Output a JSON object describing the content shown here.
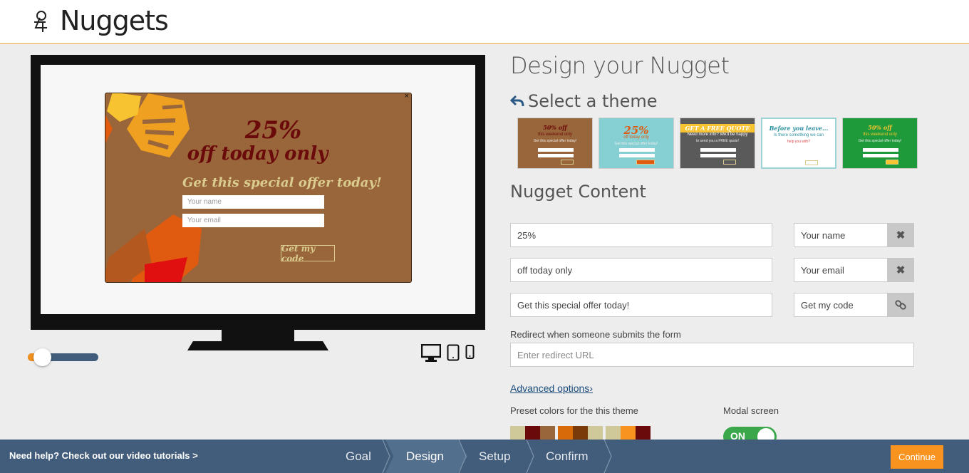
{
  "header": {
    "logo_text": "Nuggets"
  },
  "preview": {
    "popup": {
      "headline": "25%",
      "subheadline": "off today only",
      "offer_text": "Get this special offer today!",
      "name_placeholder": "Your name",
      "email_placeholder": "Your email",
      "button_label": "Get my code",
      "close_glyph": "×"
    },
    "size_slider": {
      "value_fraction": 0.2
    },
    "devices": [
      "desktop-icon",
      "tablet-icon",
      "phone-icon"
    ]
  },
  "panel": {
    "title": "Design your Nugget",
    "theme_section_title": "Select a theme",
    "themes": [
      {
        "name": "autumn",
        "bg": "#99653a",
        "line1": "50% off",
        "line2": "this weekend only",
        "line3": "Get this special offer today!"
      },
      {
        "name": "teal",
        "bg": "#86cfd3",
        "line1": "25%",
        "line2": "off today only",
        "line3": "Get this special offer today!"
      },
      {
        "name": "quote",
        "bg": "#5a5a5a",
        "line1": "GET A FREE QUOTE",
        "line2": "Need more info? We'll be happy",
        "line3": "to send you a FREE quote!"
      },
      {
        "name": "letter",
        "bg": "#ffffff",
        "line1": "Before you leave...",
        "line2": "Is there something we can",
        "line3": "help you with?"
      },
      {
        "name": "green",
        "bg": "#1e9a3a",
        "line1": "50% off",
        "line2": "this weekend only",
        "line3": "Get this special offer today!"
      }
    ],
    "content_section_title": "Nugget Content",
    "fields": {
      "headline": "25%",
      "subheadline": "off today only",
      "offer": "Get this special offer today!",
      "name_field": "Your name",
      "email_field": "Your email",
      "button_text": "Get my code"
    },
    "redirect_label": "Redirect when someone submits the form",
    "redirect_placeholder": "Enter redirect URL",
    "advanced_link": "Advanced options",
    "advanced_chevron": "›",
    "preset_label": "Preset colors for the this theme",
    "presets": [
      [
        "#cfc99a",
        "#6b0a0a",
        "#99653a"
      ],
      [
        "#d86a0a",
        "#7a3a0a",
        "#cfc99a"
      ],
      [
        "#cfc99a",
        "#f7931e",
        "#6b0a0a"
      ]
    ],
    "modal_label": "Modal screen",
    "modal_toggle": "ON"
  },
  "footer": {
    "help_text": "Need help? Check out our video tutorials >",
    "steps": [
      "Goal",
      "Design",
      "Setup",
      "Confirm"
    ],
    "active_step": "Design",
    "continue_label": "Continue"
  },
  "colors": {
    "accent": "#f7931e",
    "footer_bg": "#425d7b",
    "popup_bg": "#99653a",
    "toggle_on": "#3aa84a"
  }
}
